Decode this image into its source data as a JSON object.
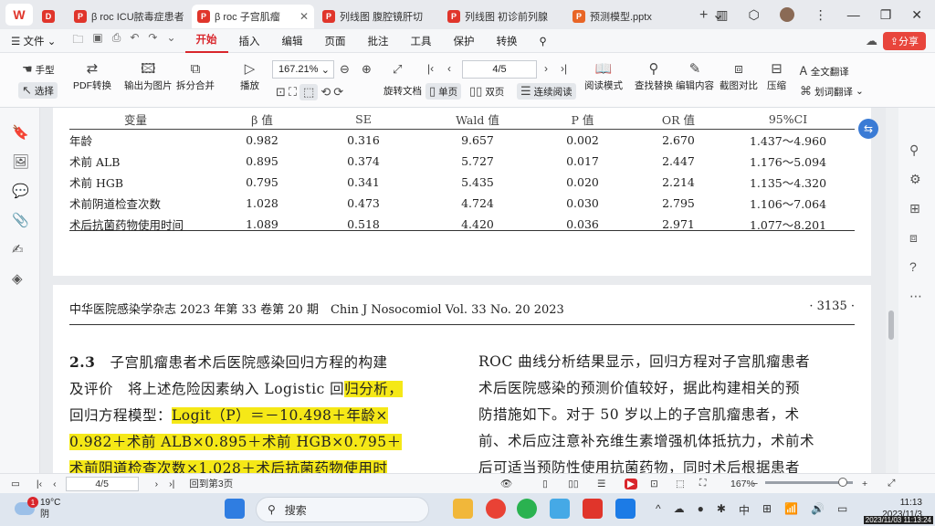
{
  "app": {
    "logo": "W"
  },
  "tabs": [
    {
      "label": "稻壳",
      "type": "docer"
    },
    {
      "label": "β roc ICU脓毒症患者",
      "type": "pdf"
    },
    {
      "label": "β roc 子宫肌瘤",
      "type": "pdf",
      "active": true
    },
    {
      "label": "列线图 腹腔镜肝切",
      "type": "pdf"
    },
    {
      "label": "列线图 初诊前列腺",
      "type": "pdf"
    },
    {
      "label": "预测模型.pptx",
      "type": "pptx"
    }
  ],
  "menu": {
    "file": "文件",
    "items": [
      "开始",
      "插入",
      "编辑",
      "页面",
      "批注",
      "工具",
      "保护",
      "转换"
    ],
    "active": "开始",
    "share": "分享"
  },
  "ribbon": {
    "hand": "手型",
    "select": "选择",
    "pdf_convert": "PDF转换",
    "export_image": "输出为图片",
    "split_merge": "拆分合并",
    "play": "播放",
    "zoom": "167.21%",
    "page": "4/5",
    "rotate": "旋转文档",
    "single": "单页",
    "double": "双页",
    "continuous": "连续阅读",
    "read_mode": "阅读模式",
    "find_replace": "查找替换",
    "edit_content": "编辑内容",
    "screenshot_compare": "截图对比",
    "compress": "压缩",
    "full_translate": "全文翻译",
    "word_translate": "划词翻译"
  },
  "table": {
    "headers": [
      "变量",
      "β 值",
      "SE",
      "Wald 值",
      "P 值",
      "OR 值",
      "95%CI"
    ],
    "rows": [
      [
        "年龄",
        "0.982",
        "0.316",
        "9.657",
        "0.002",
        "2.670",
        "1.437～4.960"
      ],
      [
        "术前 ALB",
        "0.895",
        "0.374",
        "5.727",
        "0.017",
        "2.447",
        "1.176～5.094"
      ],
      [
        "术前 HGB",
        "0.795",
        "0.341",
        "5.435",
        "0.020",
        "2.214",
        "1.135～4.320"
      ],
      [
        "术前阴道检查次数",
        "1.028",
        "0.473",
        "4.724",
        "0.030",
        "2.795",
        "1.106～7.064"
      ],
      [
        "术后抗菌药物使用时间",
        "1.089",
        "0.518",
        "4.420",
        "0.036",
        "2.971",
        "1.077～8.201"
      ]
    ]
  },
  "journal": {
    "left": "中华医院感染学杂志 2023 年第 33 卷第 20 期　Chin J Nosocomiol Vol. 33 No. 20 2023",
    "right": "· 3135 ·"
  },
  "body_left": {
    "sec": "2.3",
    "l1": "子宫肌瘤患者术后医院感染回归方程的构建",
    "l2a": "及评价　将上述危险因素纳入 Logistic 回",
    "l2b": "归分析，",
    "l3a": "回归方程模型：",
    "l3b": "Logit（P）＝－10.498＋年龄×",
    "l4": "0.982＋术前 ALB×0.895＋术前 HGB×0.795＋",
    "l5": "术前阴道检查次数×1.028＋术后抗菌药物使用时"
  },
  "body_right": [
    "ROC 曲线分析结果显示，回归方程对子宫肌瘤患者",
    "术后医院感染的预测价值较好，据此构建相关的预",
    "防措施如下。对于 50 岁以上的子宫肌瘤患者，术",
    "前、术后应注意补充维生素增强机体抵抗力，术前术",
    "后可适当预防性使用抗菌药物，同时术后根据患者"
  ],
  "status": {
    "page": "4/5",
    "back": "回到第3页",
    "zoom": "167%"
  },
  "taskbar": {
    "temp": "19°C",
    "weather": "阴",
    "badge": "1",
    "search": "搜索",
    "time": "11:13",
    "date": "2023/11/3",
    "stamp": "2023/11/03 11:13:24"
  }
}
